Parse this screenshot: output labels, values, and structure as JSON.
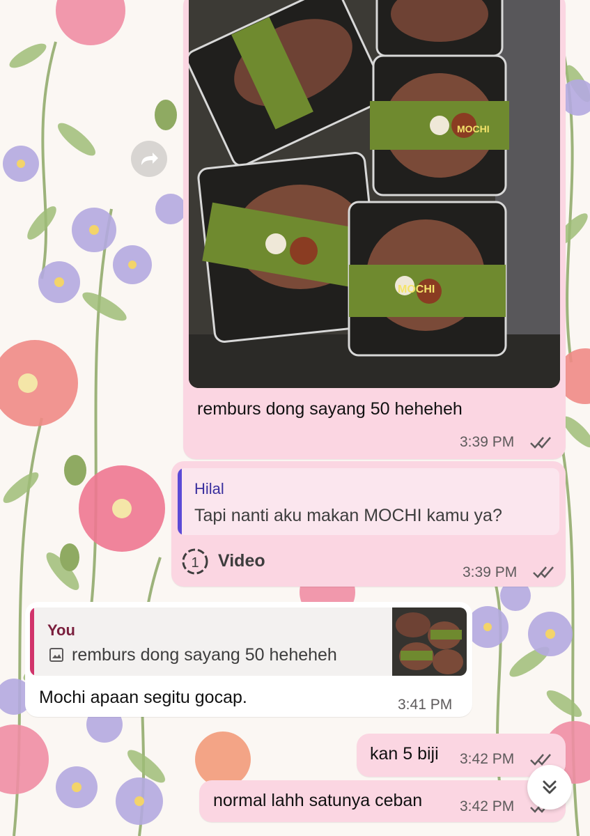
{
  "messages": {
    "m1": {
      "text": "remburs dong sayang 50 heheheh",
      "time": "3:39 PM",
      "image_icon": "mochi-photo"
    },
    "m2": {
      "quote_name": "Hilal",
      "quote_text": "Tapi nanti aku makan MOCHI kamu ya?",
      "media_label": "Video",
      "time": "3:39 PM",
      "media_icon": "view-once-icon"
    },
    "m3": {
      "quote_name": "You",
      "quote_text": "remburs dong sayang 50 heheheh",
      "text": "Mochi apaan segitu gocap.",
      "time": "3:41 PM"
    },
    "m4": {
      "text": "kan 5 biji",
      "time": "3:42 PM"
    },
    "m5": {
      "text": "normal lahh satunya ceban",
      "time": "3:42 PM"
    }
  },
  "colors": {
    "outgoing_bubble": "#fbd6e2",
    "incoming_bubble": "#ffffff",
    "quote_in_bar": "#5b4ad6",
    "quote_out_bar": "#d1346b",
    "tick": "#5d5a5b"
  },
  "photo_labels": {
    "brand": "MOCHI"
  }
}
